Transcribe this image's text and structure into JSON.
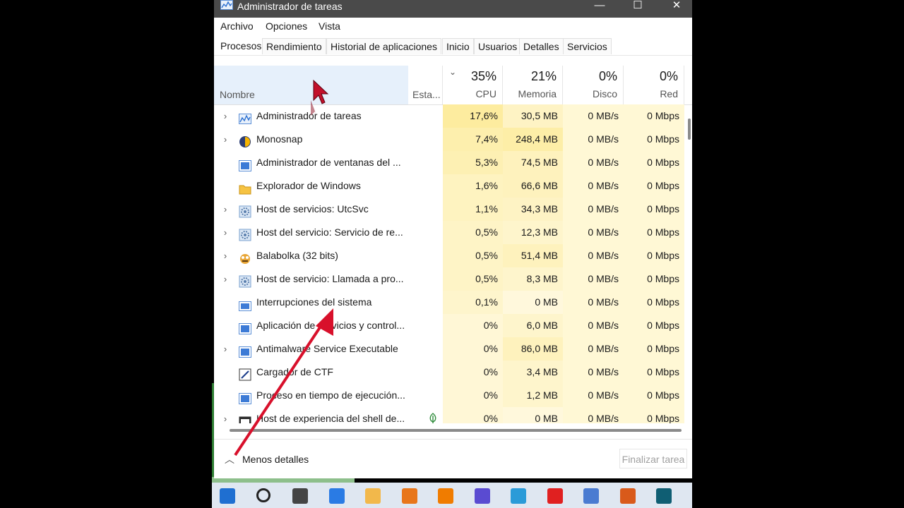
{
  "window": {
    "title": "Administrador de tareas",
    "controls": {
      "minimize": "—",
      "maximize": "☐",
      "close": "✕"
    }
  },
  "menu": [
    "Archivo",
    "Opciones",
    "Vista"
  ],
  "tabs": [
    "Procesos",
    "Rendimiento",
    "Historial de aplicaciones",
    "Inicio",
    "Usuarios",
    "Detalles",
    "Servicios"
  ],
  "columns": {
    "name": "Nombre",
    "status": "Esta...",
    "cpu": {
      "pct": "35%",
      "label": "CPU"
    },
    "memory": {
      "pct": "21%",
      "label": "Memoria"
    },
    "disk": {
      "pct": "0%",
      "label": "Disco"
    },
    "network": {
      "pct": "0%",
      "label": "Red"
    }
  },
  "processes": [
    {
      "name": "Administrador de tareas",
      "icon": "task-manager-icon",
      "expandable": true,
      "cpu": "17,6%",
      "memory": "30,5 MB",
      "disk": "0 MB/s",
      "network": "0 Mbps"
    },
    {
      "name": "Monosnap",
      "icon": "monosnap-icon",
      "expandable": true,
      "cpu": "7,4%",
      "memory": "248,4 MB",
      "disk": "0 MB/s",
      "network": "0 Mbps"
    },
    {
      "name": "Administrador de ventanas del ...",
      "icon": "window-manager-icon",
      "expandable": false,
      "cpu": "5,3%",
      "memory": "74,5 MB",
      "disk": "0 MB/s",
      "network": "0 Mbps"
    },
    {
      "name": "Explorador de Windows",
      "icon": "folder-icon",
      "expandable": false,
      "cpu": "1,6%",
      "memory": "66,6 MB",
      "disk": "0 MB/s",
      "network": "0 Mbps"
    },
    {
      "name": "Host de servicios: UtcSvc",
      "icon": "gear-icon",
      "expandable": true,
      "cpu": "1,1%",
      "memory": "34,3 MB",
      "disk": "0 MB/s",
      "network": "0 Mbps"
    },
    {
      "name": "Host del servicio: Servicio de re...",
      "icon": "gear-icon",
      "expandable": true,
      "cpu": "0,5%",
      "memory": "12,3 MB",
      "disk": "0 MB/s",
      "network": "0 Mbps"
    },
    {
      "name": "Balabolka (32 bits)",
      "icon": "balabolka-icon",
      "expandable": true,
      "cpu": "0,5%",
      "memory": "51,4 MB",
      "disk": "0 MB/s",
      "network": "0 Mbps"
    },
    {
      "name": "Host de servicio: Llamada a pro...",
      "icon": "gear-icon",
      "expandable": true,
      "cpu": "0,5%",
      "memory": "8,3 MB",
      "disk": "0 MB/s",
      "network": "0 Mbps"
    },
    {
      "name": "Interrupciones del sistema",
      "icon": "system-icon",
      "expandable": false,
      "cpu": "0,1%",
      "memory": "0 MB",
      "disk": "0 MB/s",
      "network": "0 Mbps"
    },
    {
      "name": "Aplicación de servicios y control...",
      "icon": "window-manager-icon",
      "expandable": false,
      "cpu": "0%",
      "memory": "6,0 MB",
      "disk": "0 MB/s",
      "network": "0 Mbps"
    },
    {
      "name": "Antimalware Service Executable",
      "icon": "window-manager-icon",
      "expandable": true,
      "cpu": "0%",
      "memory": "86,0 MB",
      "disk": "0 MB/s",
      "network": "0 Mbps"
    },
    {
      "name": "Cargador de CTF",
      "icon": "ctf-icon",
      "expandable": false,
      "cpu": "0%",
      "memory": "3,4 MB",
      "disk": "0 MB/s",
      "network": "0 Mbps"
    },
    {
      "name": "Proceso en tiempo de ejecución...",
      "icon": "window-manager-icon",
      "expandable": false,
      "cpu": "0%",
      "memory": "1,2 MB",
      "disk": "0 MB/s",
      "network": "0 Mbps"
    },
    {
      "name": "Host de experiencia del shell de...",
      "icon": "shell-icon",
      "expandable": true,
      "cpu": "0%",
      "memory": "0 MB",
      "disk": "0 MB/s",
      "network": "0 Mbps",
      "status_icon": "leaf-icon"
    }
  ],
  "footer": {
    "less_details": "Menos detalles",
    "end_task": "Finalizar tarea"
  },
  "colors": {
    "cpu_high": "#fdeea5",
    "cpu_low": "#fff6cc",
    "mem_high": "#fdf2b8",
    "default": "#fff8d5",
    "header_selected": "#e6f0fb",
    "arrow": "#d8102b"
  },
  "taskbar": [
    "windows-start-icon",
    "search-icon",
    "task-view-icon",
    "app-blue-icon",
    "file-explorer-icon",
    "search-app-icon",
    "vlc-icon",
    "dark-app-icon",
    "telegram-icon",
    "red-app-icon",
    "task-manager-icon",
    "chrome-like-icon",
    "teal-app-icon"
  ]
}
